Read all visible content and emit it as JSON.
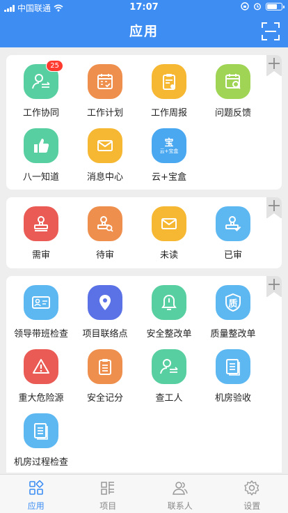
{
  "status_bar": {
    "carrier": "中国联通",
    "time": "17:07"
  },
  "header": {
    "title": "应用"
  },
  "sections": [
    {
      "items": [
        {
          "label": "工作协同",
          "icon": "user-transfer-icon",
          "badge": "25"
        },
        {
          "label": "工作计划",
          "icon": "calendar-check-icon"
        },
        {
          "label": "工作周报",
          "icon": "clipboard-report-icon"
        },
        {
          "label": "问题反馈",
          "icon": "calendar-search-icon"
        },
        {
          "label": "八一知道",
          "icon": "thumbs-up-icon"
        },
        {
          "label": "消息中心",
          "icon": "envelope-icon"
        },
        {
          "label": "云+宝盒",
          "icon": "cloud-box-icon",
          "icon_text_top": "宝",
          "icon_text_bottom": "云+宝盒"
        }
      ]
    },
    {
      "items": [
        {
          "label": "需审",
          "icon": "stamp-icon"
        },
        {
          "label": "待审",
          "icon": "stamp-search-icon"
        },
        {
          "label": "未读",
          "icon": "envelope-icon"
        },
        {
          "label": "已审",
          "icon": "shield-check-icon"
        }
      ]
    },
    {
      "items": [
        {
          "label": "领导带班检查",
          "icon": "id-card-icon"
        },
        {
          "label": "项目联络点",
          "icon": "map-pin-icon"
        },
        {
          "label": "安全整改单",
          "icon": "bell-icon"
        },
        {
          "label": "质量整改单",
          "icon": "quality-shield-icon",
          "icon_text": "质"
        },
        {
          "label": "重大危险源",
          "icon": "warning-icon"
        },
        {
          "label": "安全记分",
          "icon": "clipboard-list-icon"
        },
        {
          "label": "查工人",
          "icon": "user-transfer-icon"
        },
        {
          "label": "机房验收",
          "icon": "document-icon"
        },
        {
          "label": "机房过程检查",
          "icon": "document-icon"
        }
      ]
    }
  ],
  "tabbar": [
    {
      "label": "应用",
      "icon": "grid-apps-icon",
      "active": true
    },
    {
      "label": "项目",
      "icon": "project-icon",
      "active": false
    },
    {
      "label": "联系人",
      "icon": "contacts-icon",
      "active": false
    },
    {
      "label": "设置",
      "icon": "settings-gear-icon",
      "active": false
    }
  ]
}
